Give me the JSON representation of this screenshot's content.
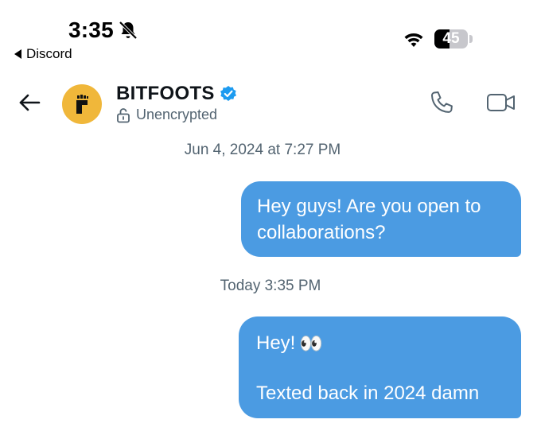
{
  "status_bar": {
    "time": "3:35",
    "back_app_label": "Discord",
    "battery_level": "45",
    "battery_fraction": 0.45
  },
  "header": {
    "contact_name": "BITFOOTS",
    "verified": true,
    "encryption_status": "Unencrypted",
    "avatar_color": "#f0b73a",
    "icons": [
      "back-arrow-icon",
      "verified-badge-icon",
      "unlocked-icon",
      "phone-icon",
      "video-camera-icon",
      "bell-slash-icon",
      "wifi-icon"
    ]
  },
  "messages": [
    {
      "timestamp": "Jun 4, 2024 at 7:27 PM",
      "text": "Hey guys! Are you open to collaborations?",
      "from": "me"
    },
    {
      "timestamp": "Today 3:35 PM",
      "lines": [
        "Hey!",
        "Texted back in 2024 damn"
      ],
      "emoji": "👀",
      "from": "me"
    }
  ],
  "colors": {
    "bubble": "#4b9be2",
    "secondary_text": "#536471",
    "verified": "#1d9bf0"
  }
}
